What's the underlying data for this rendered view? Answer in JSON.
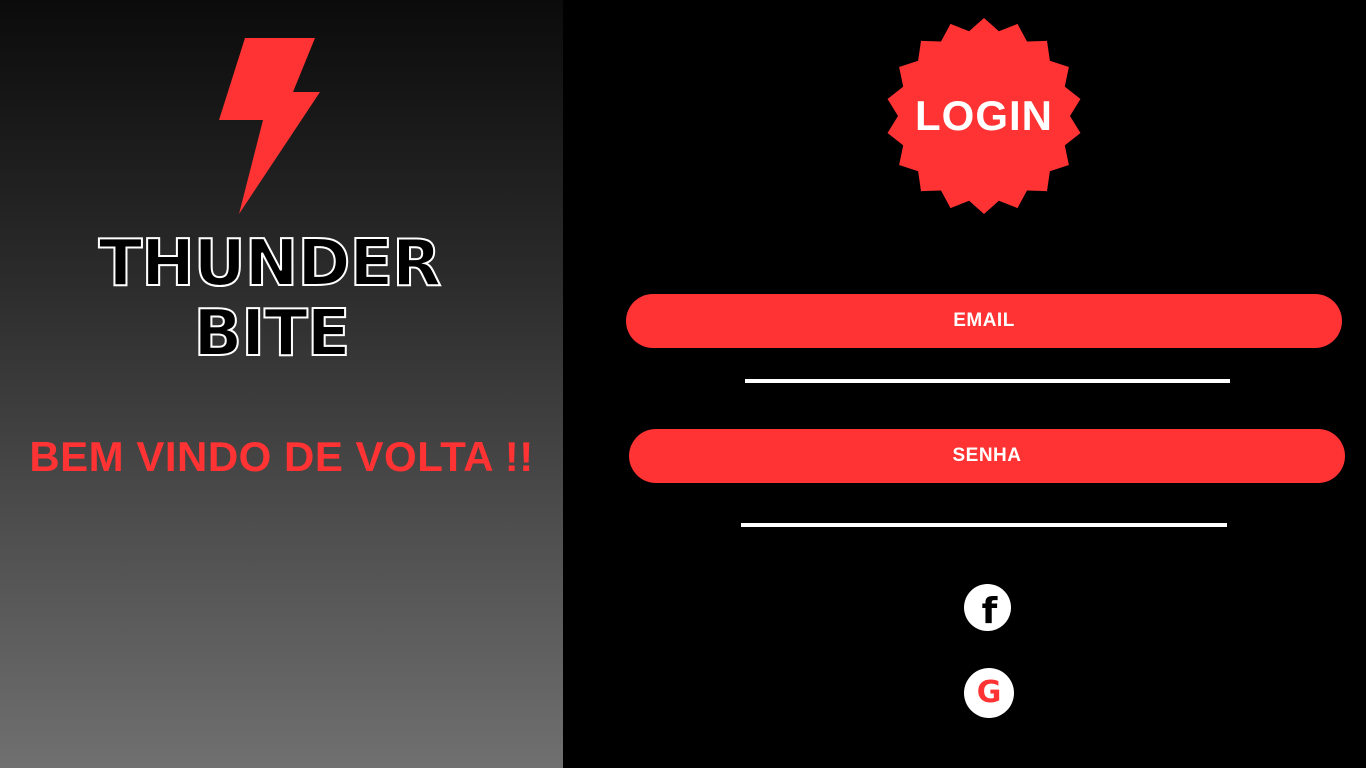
{
  "brand": {
    "logo_icon": "lightning-bolt-icon",
    "line1": "THUNDER",
    "line2": "BITE",
    "accent_color": "#ff3333"
  },
  "welcome_text": "BEM VINDO DE VOLTA !!",
  "login_badge": {
    "label": "LOGIN"
  },
  "form": {
    "email_label": "EMAIL",
    "password_label": "SENHA"
  },
  "social": {
    "facebook_icon": "facebook-icon",
    "facebook_glyph": "f",
    "google_icon": "google-icon",
    "google_glyph": "G"
  }
}
